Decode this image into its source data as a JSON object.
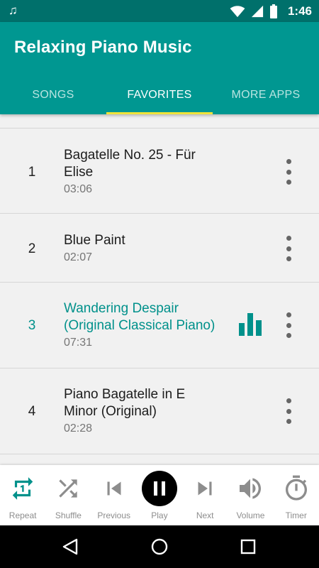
{
  "status_bar": {
    "time": "1:46",
    "icons": [
      "music-note-icon",
      "wifi-icon",
      "cellular-signal-icon",
      "battery-icon"
    ]
  },
  "app": {
    "title": "Relaxing Piano Music",
    "primary_color": "#009791",
    "status_color": "#00706b",
    "accent_color": "#f1e43a"
  },
  "tabs": [
    {
      "label": "SONGS",
      "active": false
    },
    {
      "label": "FAVORITES",
      "active": true
    },
    {
      "label": "MORE APPS",
      "active": false
    }
  ],
  "songs": [
    {
      "num": "1",
      "title_lines": [
        "Bagatelle No. 25 - Für",
        "Elise"
      ],
      "duration": "03:06",
      "playing": false
    },
    {
      "num": "2",
      "title_lines": [
        "Blue Paint"
      ],
      "duration": "02:07",
      "playing": false
    },
    {
      "num": "3",
      "title_lines": [
        "Wandering Despair",
        "(Original Classical Piano)"
      ],
      "duration": "07:31",
      "playing": true
    },
    {
      "num": "4",
      "title_lines": [
        "Piano Bagatelle in E",
        "Minor (Original)"
      ],
      "duration": "02:28",
      "playing": false
    }
  ],
  "controls": [
    {
      "label": "Repeat",
      "icon": "repeat-one-icon",
      "active": true
    },
    {
      "label": "Shuffle",
      "icon": "shuffle-icon",
      "active": false
    },
    {
      "label": "Previous",
      "icon": "skip-previous-icon",
      "active": false
    },
    {
      "label": "Play",
      "icon": "pause-icon",
      "active": false
    },
    {
      "label": "Next",
      "icon": "skip-next-icon",
      "active": false
    },
    {
      "label": "Volume",
      "icon": "volume-icon",
      "active": false
    },
    {
      "label": "Timer",
      "icon": "timer-icon",
      "active": false
    }
  ],
  "nav": [
    "back-icon",
    "home-icon",
    "recents-icon"
  ]
}
